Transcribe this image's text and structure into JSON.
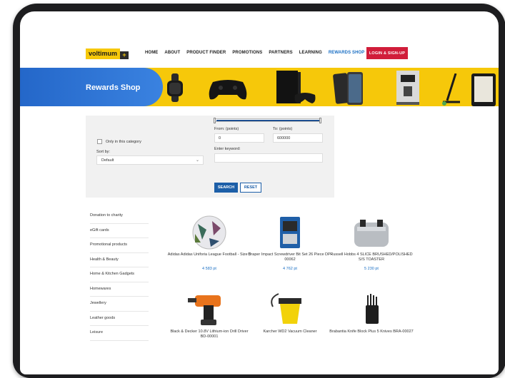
{
  "logo": {
    "text": "voltimum",
    "plus": "+"
  },
  "nav": {
    "items": [
      "HOME",
      "ABOUT",
      "PRODUCT FINDER",
      "PROMOTIONS",
      "PARTNERS",
      "LEARNING",
      "REWARDS SHOP"
    ],
    "active": "REWARDS SHOP",
    "login_label": "LOGIN & SIGN-UP"
  },
  "banner": {
    "title": "Rewards Shop"
  },
  "filter": {
    "only_category_label": "Only in this category",
    "sort_label": "Sort by:",
    "sort_value": "Default",
    "from_label": "From: (points)",
    "from_value": "0",
    "to_label": "To: (points)",
    "to_value": "600000",
    "keyword_label": "Enter keyword:",
    "keyword_value": "",
    "search_label": "SEARCH",
    "reset_label": "RESET"
  },
  "sidebar": {
    "items": [
      "Donation to charity",
      "eGift cards",
      "Promotional products",
      "Health & Beauty",
      "Home & Kitchen Gadgets",
      "Homewares",
      "Jewellery",
      "Leather goods",
      "Leisure"
    ]
  },
  "products": [
    {
      "name": "Adidas Adidas Uniforia League Football - Size 5",
      "price": "4 583 pt"
    },
    {
      "name": "Draper Impact Screwdriver Bit Set 26 Piece DP-00062",
      "price": "4 762 pt"
    },
    {
      "name": "Russell Hobbs 4 SLICE BRUSHED/POLISHED S/S TOASTER",
      "price": "5 230 pt"
    },
    {
      "name": "Black & Decker 10.8V Lithium-ion Drill Driver BD-00001",
      "price": ""
    },
    {
      "name": "Karcher WD2 Vacuum Cleaner",
      "price": ""
    },
    {
      "name": "Brabantia Knife Block Plus 5 Knives BRA-00027",
      "price": ""
    }
  ],
  "colors": {
    "accent_yellow": "#f6c80a",
    "brand_blue": "#1d5fa8",
    "login_red": "#d11d3a"
  }
}
